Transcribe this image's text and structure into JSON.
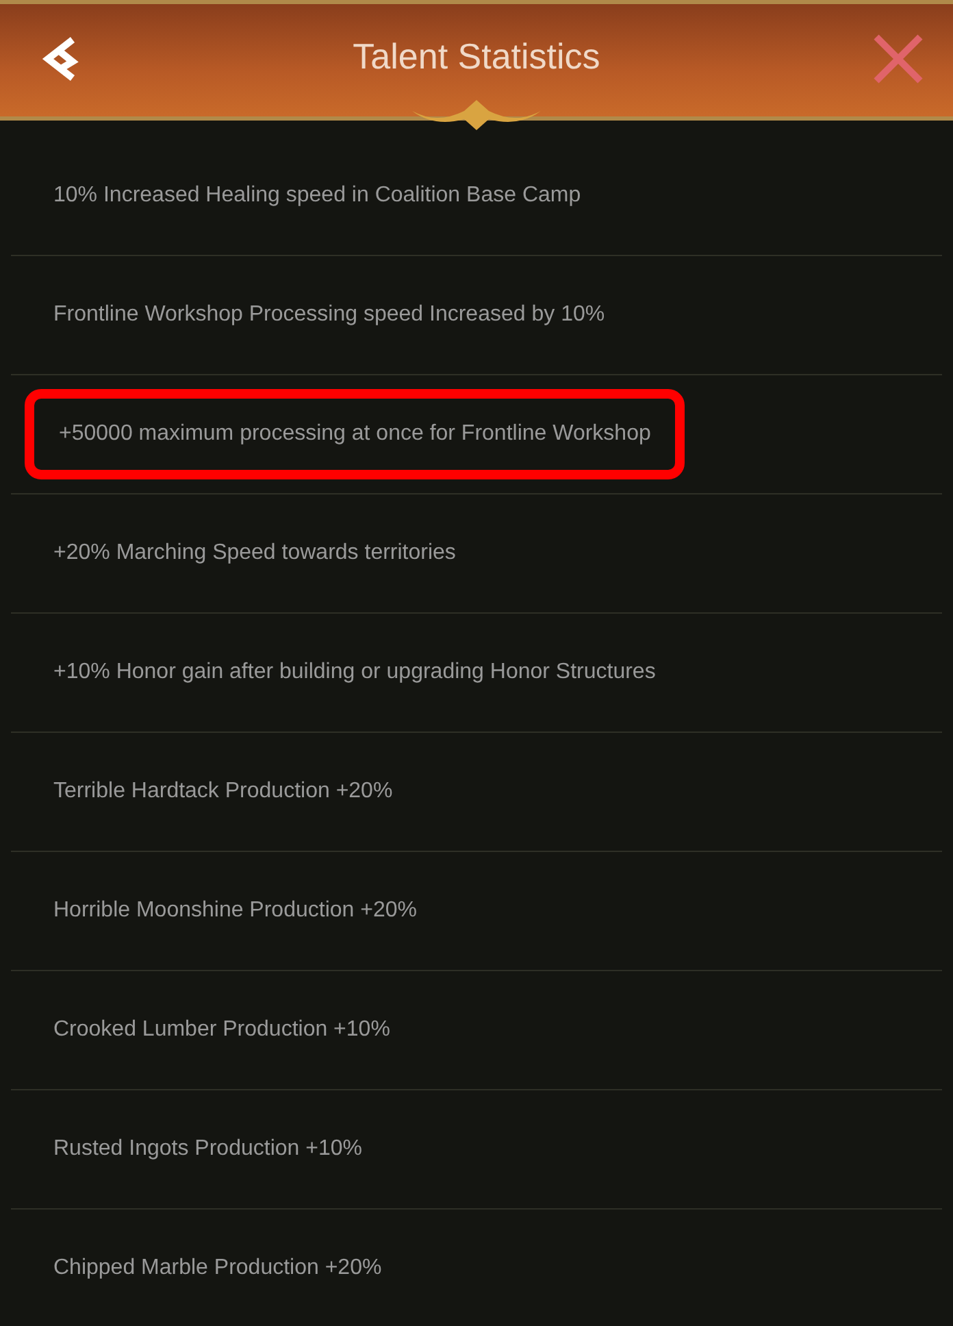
{
  "header": {
    "title": "Talent Statistics"
  },
  "stats": [
    {
      "text": "10% Increased Healing speed in Coalition Base Camp",
      "highlighted": false
    },
    {
      "text": "Frontline Workshop Processing speed Increased by 10%",
      "highlighted": false
    },
    {
      "text": "+50000 maximum processing at once for Frontline Workshop",
      "highlighted": true
    },
    {
      "text": "+20% Marching Speed towards territories",
      "highlighted": false
    },
    {
      "text": "+10% Honor gain after building or upgrading Honor Structures",
      "highlighted": false
    },
    {
      "text": "Terrible Hardtack Production +20%",
      "highlighted": false
    },
    {
      "text": "Horrible Moonshine Production +20%",
      "highlighted": false
    },
    {
      "text": "Crooked Lumber Production +10%",
      "highlighted": false
    },
    {
      "text": "Rusted Ingots Production +10%",
      "highlighted": false
    },
    {
      "text": "Chipped Marble Production +20%",
      "highlighted": false
    }
  ]
}
